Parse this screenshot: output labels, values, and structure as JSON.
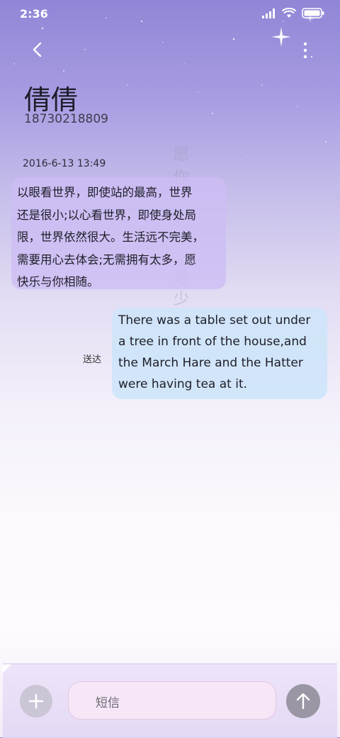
{
  "status_bar": {
    "time": "2:36",
    "icons": [
      "signal-icon",
      "wifi-icon",
      "battery-icon"
    ]
  },
  "header": {
    "back_icon": "chevron-left-icon",
    "menu_icon": "more-vertical-icon"
  },
  "contact": {
    "name": "倩倩",
    "phone": "18730218809"
  },
  "conversation": {
    "timestamp": "2016-6-13 13:49",
    "messages": [
      {
        "direction": "incoming",
        "lines": [
          "以眼看世界，即使站的最高，世界",
          "还是很小;以心看世界，即使身处局",
          "限，世界依然很大。生活远不完美，",
          "需要用心去体会;无需拥有太多，愿",
          "快乐与你相随。"
        ]
      },
      {
        "direction": "outgoing",
        "status": "送达",
        "lines": [
          "There was a table set out under",
          "a tree in front of the house,and",
          "the March Hare and the Hatter",
          "were having tea at it."
        ]
      }
    ]
  },
  "composer": {
    "add_icon": "plus-icon",
    "placeholder": "短信",
    "send_icon": "arrow-up-icon"
  },
  "colors": {
    "incoming_bubble": "#cdbcf5",
    "outgoing_bubble": "#cee4fa",
    "send_button": "#9a96a4",
    "add_button": "#cbc6d6"
  }
}
